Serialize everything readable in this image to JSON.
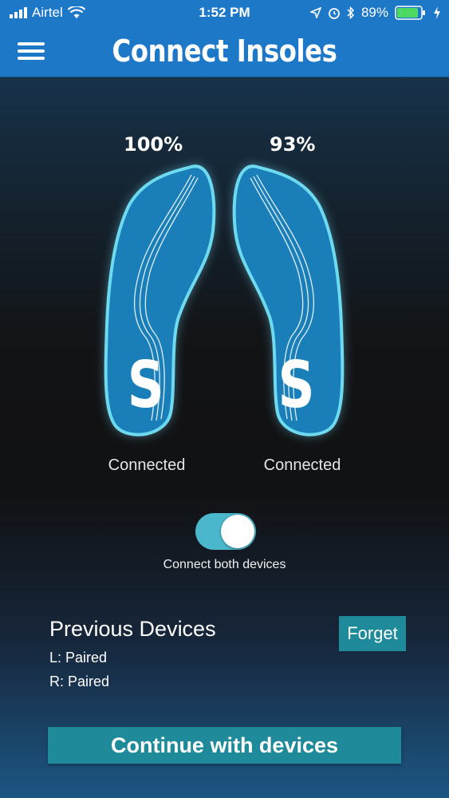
{
  "status_bar": {
    "carrier": "Airtel",
    "time": "1:52 PM",
    "battery_percent": "89%"
  },
  "nav": {
    "title": "Connect Insoles",
    "menu_icon": "hamburger-icon"
  },
  "insoles": {
    "left": {
      "battery": "100%",
      "status": "Connected",
      "logo": "S"
    },
    "right": {
      "battery": "93%",
      "status": "Connected",
      "logo": "S"
    }
  },
  "toggle": {
    "label": "Connect both devices",
    "on": true
  },
  "previous_devices": {
    "title": "Previous Devices",
    "left": "L: Paired",
    "right": "R: Paired",
    "forget_label": "Forget"
  },
  "continue_label": "Continue with devices",
  "colors": {
    "header": "#1e78c8",
    "accent": "#1f8b9a",
    "toggle": "#4bb7cc",
    "insole": "#1a7fb8"
  }
}
